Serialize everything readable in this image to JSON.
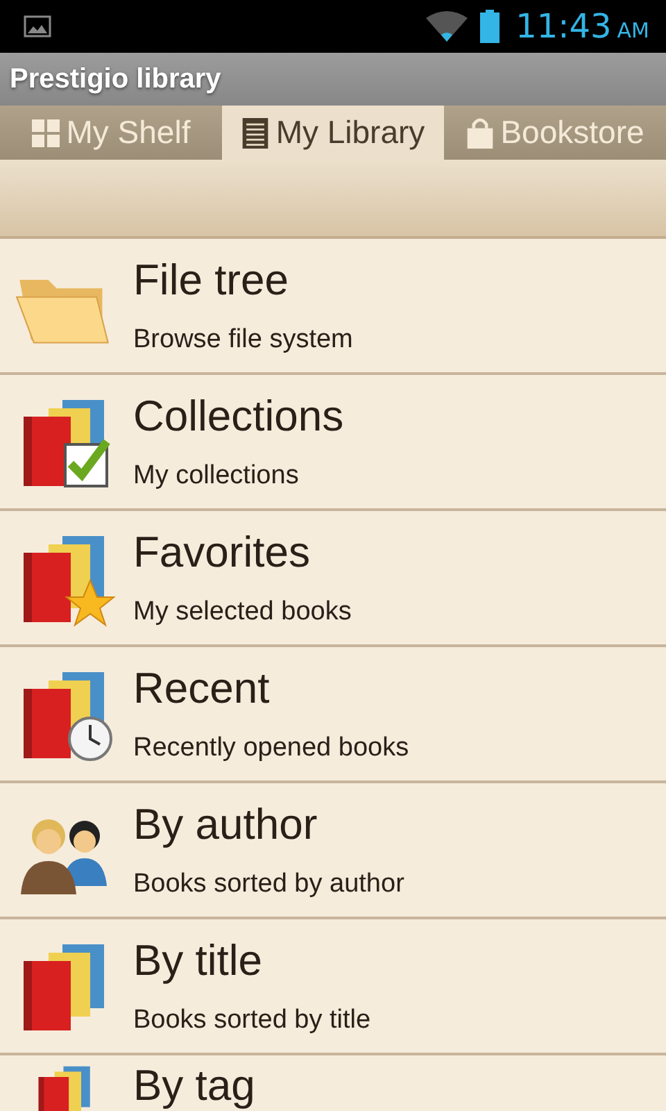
{
  "status_bar": {
    "time": "11:43",
    "ampm": "AM"
  },
  "app_bar": {
    "title": "Prestigio library"
  },
  "tabs": [
    {
      "label": "My Shelf",
      "kind": "grid",
      "selected": false
    },
    {
      "label": "My Library",
      "kind": "list",
      "selected": true
    },
    {
      "label": "Bookstore",
      "kind": "store",
      "selected": false
    }
  ],
  "items": [
    {
      "kind": "folder",
      "title": "File tree",
      "subtitle": "Browse file system"
    },
    {
      "kind": "checked",
      "title": "Collections",
      "subtitle": "My collections"
    },
    {
      "kind": "starred",
      "title": "Favorites",
      "subtitle": "My selected books"
    },
    {
      "kind": "recent",
      "title": "Recent",
      "subtitle": "Recently opened books"
    },
    {
      "kind": "people",
      "title": "By author",
      "subtitle": "Books sorted by author"
    },
    {
      "kind": "books",
      "title": "By title",
      "subtitle": "Books sorted by title"
    },
    {
      "kind": "books",
      "title": "By tag"
    }
  ]
}
